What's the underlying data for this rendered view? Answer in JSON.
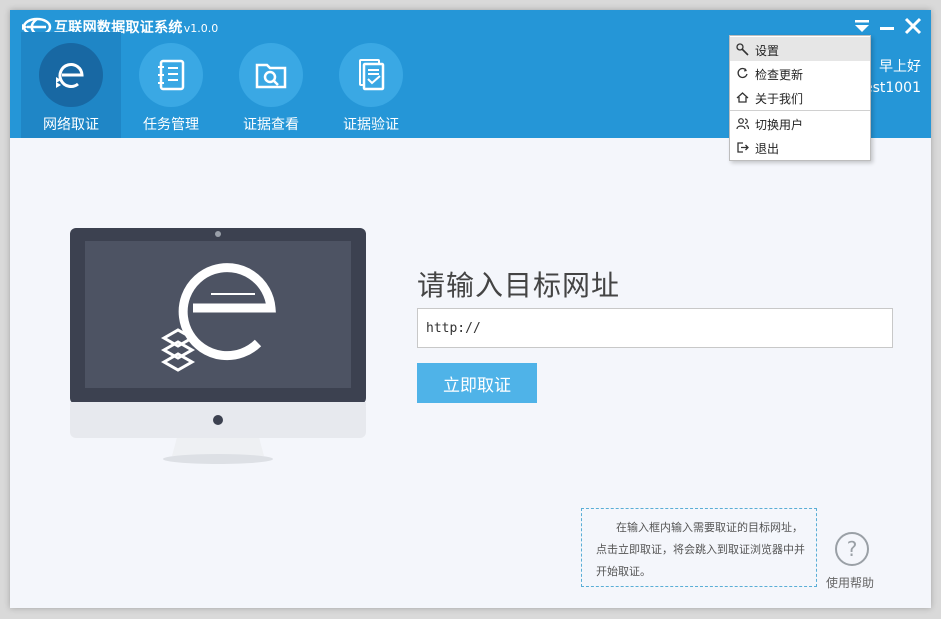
{
  "app": {
    "title": "互联网数据取证系统",
    "version": "v1.0.0"
  },
  "window_controls": {
    "menu_icon": "menu-arrow-icon",
    "minimize_icon": "minimize-icon",
    "close_icon": "close-icon"
  },
  "nav": {
    "tabs": [
      {
        "label": "网络取证",
        "icon": "evidence-e-icon",
        "active": true
      },
      {
        "label": "任务管理",
        "icon": "notebook-icon",
        "active": false
      },
      {
        "label": "证据查看",
        "icon": "folder-search-icon",
        "active": false
      },
      {
        "label": "证据验证",
        "icon": "document-check-icon",
        "active": false
      }
    ]
  },
  "user": {
    "greeting": "早上好",
    "name": "est1001"
  },
  "menu": {
    "items": [
      {
        "label": "设置",
        "icon": "wrench-icon",
        "highlighted": true
      },
      {
        "label": "检查更新",
        "icon": "refresh-icon"
      },
      {
        "label": "关于我们",
        "icon": "home-icon"
      },
      {
        "label": "切换用户",
        "icon": "users-icon"
      },
      {
        "label": "退出",
        "icon": "exit-icon"
      }
    ]
  },
  "main": {
    "prompt": "请输入目标网址",
    "url_value": "http://",
    "submit_label": "立即取证",
    "hint": "在输入框内输入需要取证的目标网址，点击立即取证，将会跳入到取证浏览器中并开始取证。",
    "help_label": "使用帮助",
    "help_symbol": "?"
  },
  "colors": {
    "header": "#2596d7",
    "active_tab": "#1f86c6",
    "button": "#4fb3e8",
    "background": "#f4f6fb",
    "monitor_dark": "#3c4150"
  }
}
